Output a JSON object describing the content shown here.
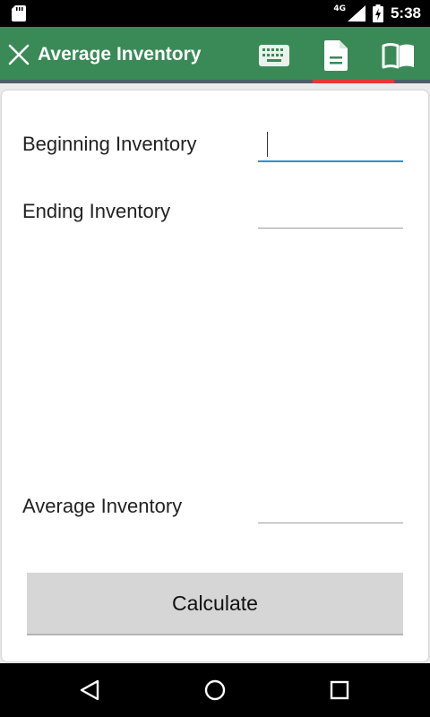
{
  "status_bar": {
    "network_type": "4G",
    "time": "5:38",
    "icons": [
      "sd-card-icon",
      "signal-icon",
      "battery-charging-icon"
    ]
  },
  "toolbar": {
    "title": "Average Inventory",
    "close_icon": "close-icon",
    "actions": [
      "keyboard-icon",
      "document-icon",
      "book-icon"
    ],
    "active_tab": "document",
    "color": "#3a8a57",
    "indicator_color": "#e53935"
  },
  "form": {
    "beginning_label": "Beginning Inventory",
    "beginning_value": "",
    "ending_label": "Ending Inventory",
    "ending_value": "",
    "average_label": "Average Inventory",
    "average_value": "",
    "calculate_label": "Calculate"
  },
  "nav_bar": {
    "icons": [
      "back-icon",
      "home-icon",
      "recents-icon"
    ]
  }
}
